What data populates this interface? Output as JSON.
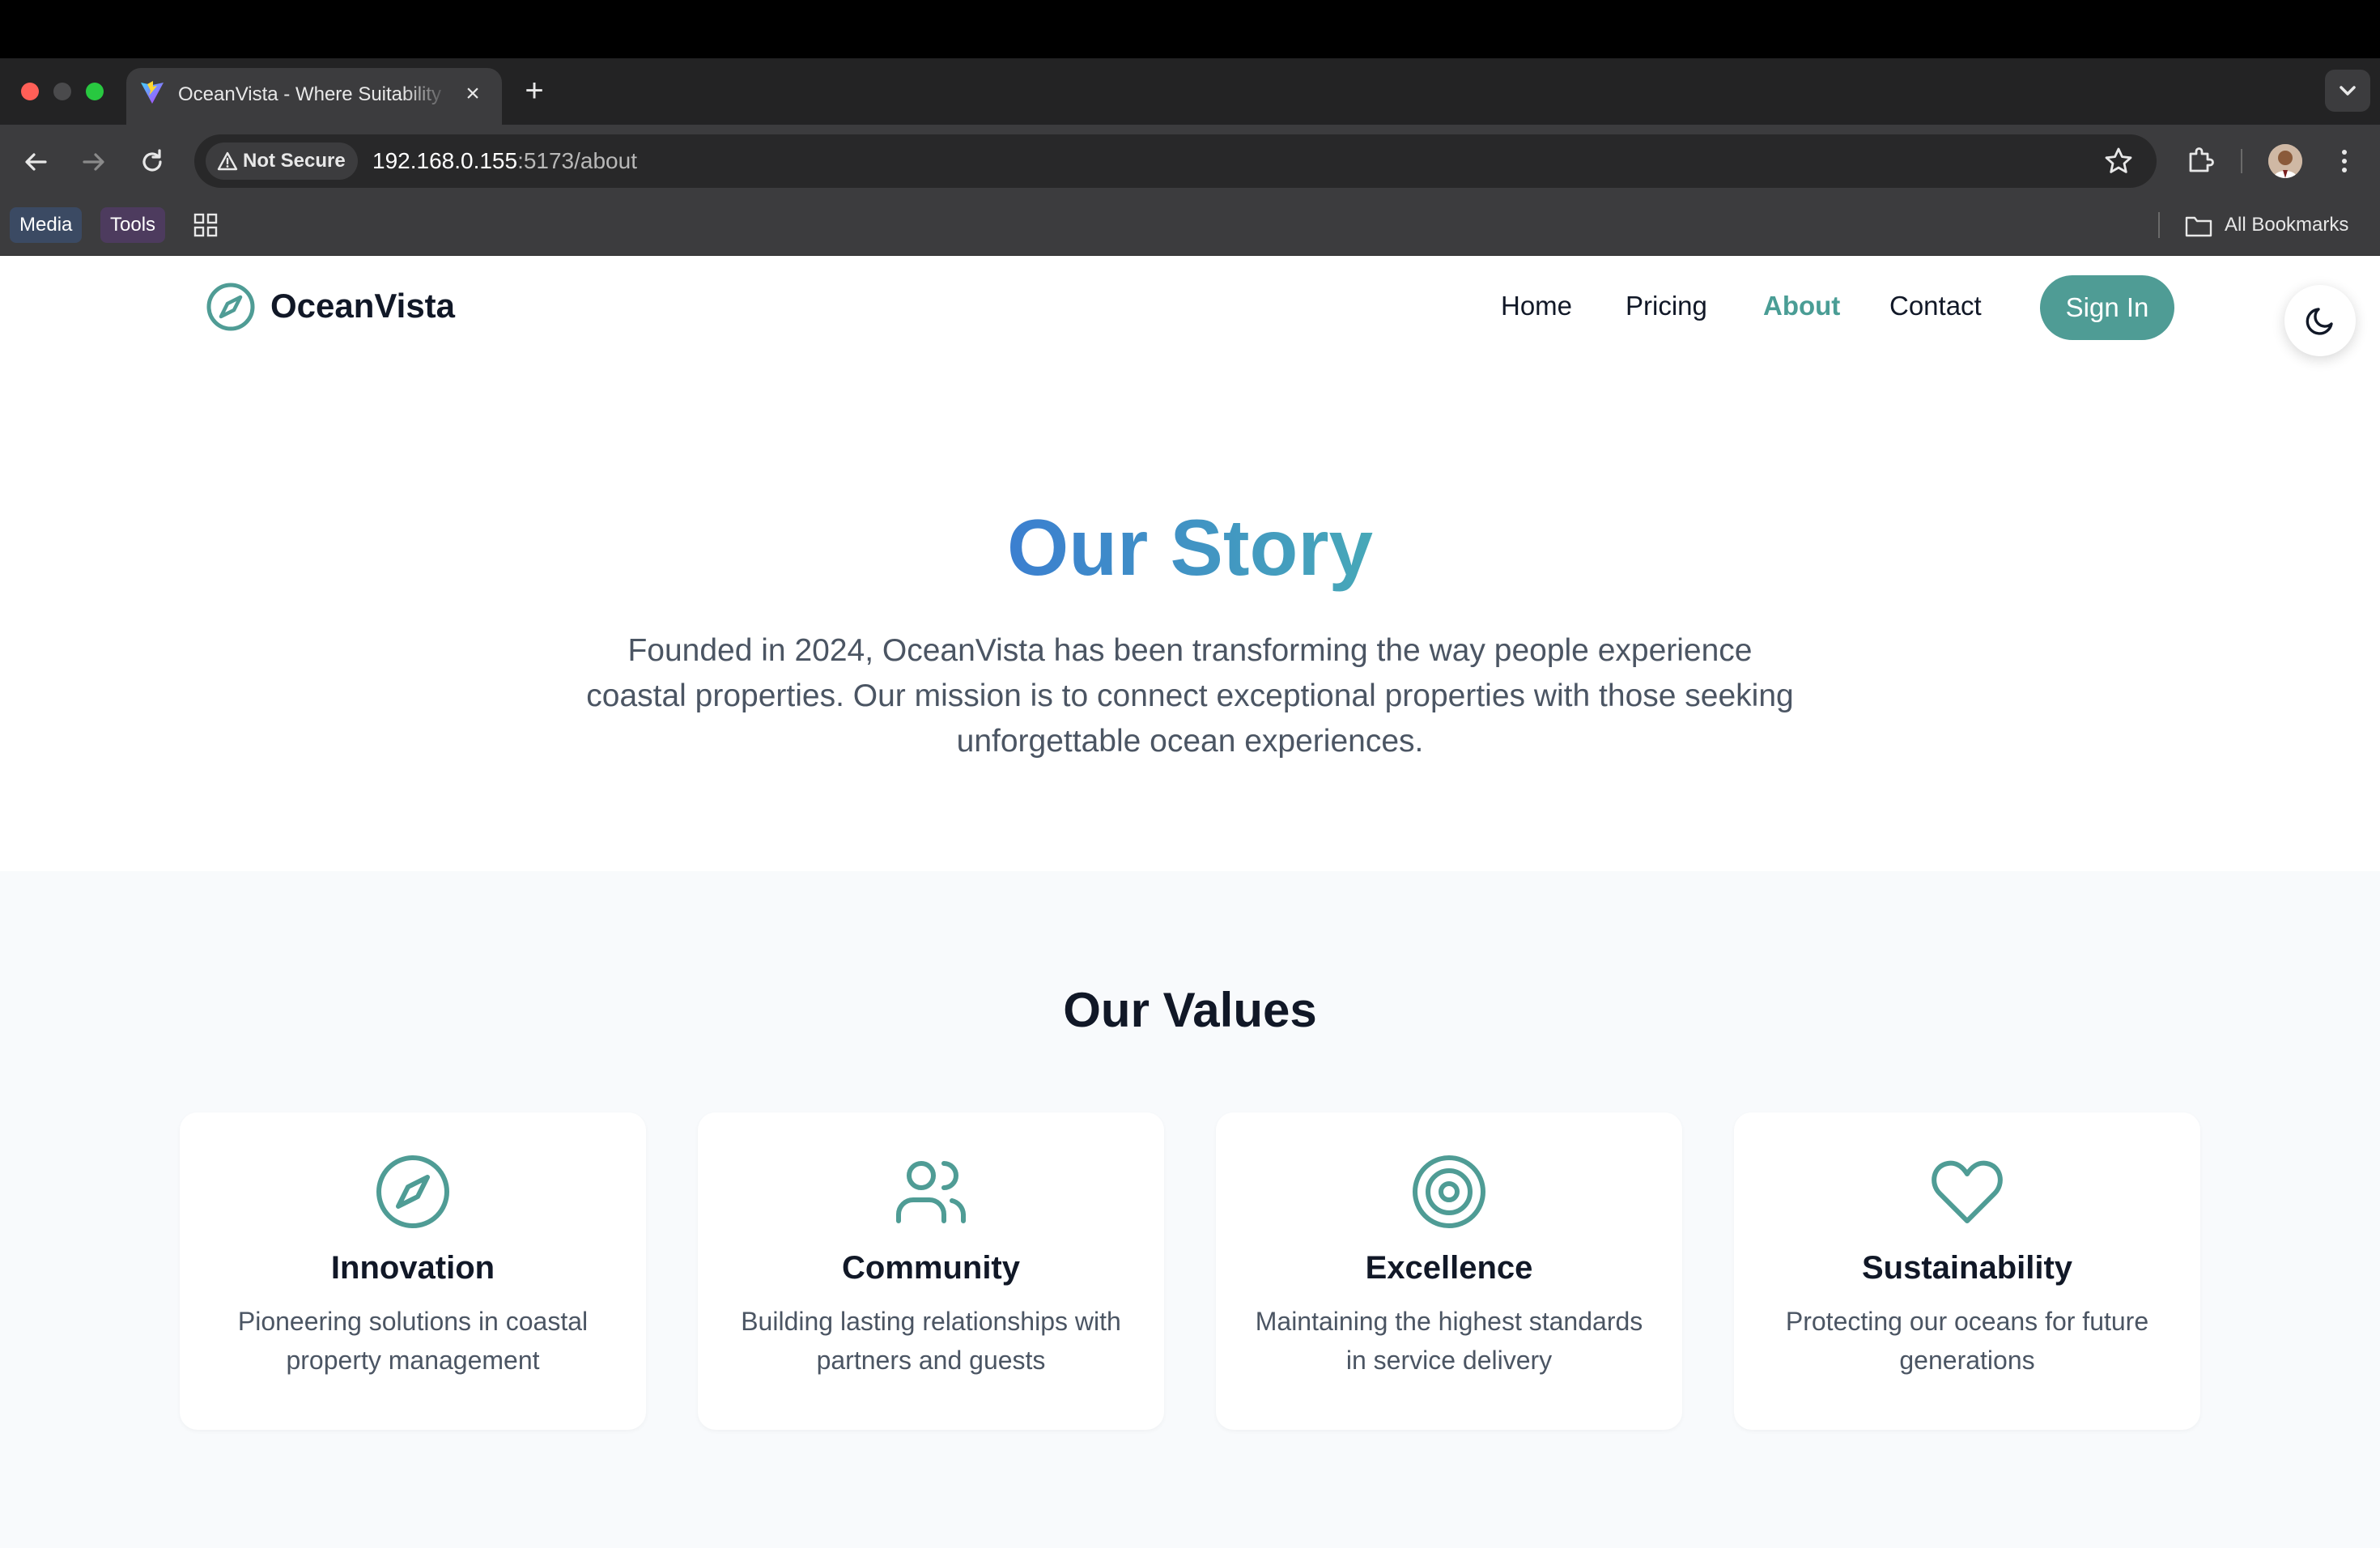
{
  "browser": {
    "tab_title": "OceanVista - Where Suitability",
    "tab_close": "×",
    "new_tab": "+",
    "security_label": "Not Secure",
    "url_host": "192.168.0.155",
    "url_path": ":5173/about",
    "bookmarks": [
      {
        "label": "Media"
      },
      {
        "label": "Tools"
      }
    ],
    "all_bookmarks": "All Bookmarks"
  },
  "nav": {
    "brand": "OceanVista",
    "links": [
      {
        "label": "Home"
      },
      {
        "label": "Pricing"
      },
      {
        "label": "About",
        "active": true
      },
      {
        "label": "Contact"
      }
    ],
    "signin": "Sign In",
    "theme_icon": "moon-icon"
  },
  "story": {
    "title": "Our Story",
    "text": "Founded in 2024, OceanVista has been transforming the way people experience coastal properties. Our mission is to connect exceptional properties with those seeking unforgettable ocean experiences."
  },
  "values": {
    "title": "Our Values",
    "items": [
      {
        "icon": "compass-icon",
        "title": "Innovation",
        "text": "Pioneering solutions in coastal property management"
      },
      {
        "icon": "users-icon",
        "title": "Community",
        "text": "Building lasting relationships with partners and guests"
      },
      {
        "icon": "target-icon",
        "title": "Excellence",
        "text": "Maintaining the highest standards in service delivery"
      },
      {
        "icon": "heart-icon",
        "title": "Sustainability",
        "text": "Protecting our oceans for future generations"
      }
    ]
  },
  "colors": {
    "accent": "#4f9c95",
    "title_gradient_start": "#3b7fd0",
    "title_gradient_end": "#47a8b8",
    "chrome_dark": "#232324",
    "chrome_toolbar": "#3c3c3e"
  }
}
